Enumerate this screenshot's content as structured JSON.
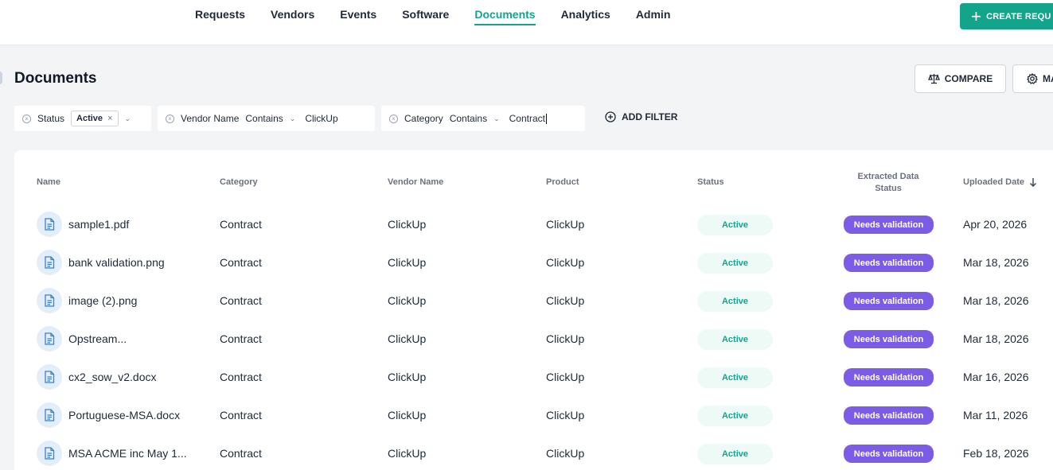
{
  "nav": {
    "items": [
      {
        "label": "Requests",
        "active": false
      },
      {
        "label": "Vendors",
        "active": false
      },
      {
        "label": "Events",
        "active": false
      },
      {
        "label": "Software",
        "active": false
      },
      {
        "label": "Documents",
        "active": true
      },
      {
        "label": "Analytics",
        "active": false
      },
      {
        "label": "Admin",
        "active": false
      }
    ],
    "create_label": "CREATE REQU",
    "accent_color": "#14a38b"
  },
  "page": {
    "title": "Documents",
    "compare_label": "COMPARE",
    "manage_label": "MA"
  },
  "filters": {
    "status": {
      "label": "Status",
      "chip": "Active"
    },
    "vendor": {
      "label": "Vendor Name",
      "operator": "Contains",
      "value": "ClickUp"
    },
    "category": {
      "label": "Category",
      "operator": "Contains",
      "value": "Contract"
    },
    "add_label": "ADD FILTER"
  },
  "table": {
    "headers": {
      "name": "Name",
      "category": "Category",
      "vendor": "Vendor Name",
      "product": "Product",
      "status": "Status",
      "extracted_line1": "Extracted Data",
      "extracted_line2": "Status",
      "uploaded": "Uploaded Date"
    },
    "sort_icon": "arrow-down-icon",
    "rows": [
      {
        "name": "sample1.pdf",
        "category": "Contract",
        "vendor": "ClickUp",
        "product": "ClickUp",
        "status": "Active",
        "extracted": "Needs validation",
        "date": "Apr 20, 2026"
      },
      {
        "name": "bank validation.png",
        "category": "Contract",
        "vendor": "ClickUp",
        "product": "ClickUp",
        "status": "Active",
        "extracted": "Needs validation",
        "date": "Mar 18, 2026"
      },
      {
        "name": "image (2).png",
        "category": "Contract",
        "vendor": "ClickUp",
        "product": "ClickUp",
        "status": "Active",
        "extracted": "Needs validation",
        "date": "Mar 18, 2026"
      },
      {
        "name": "Opstream...",
        "category": "Contract",
        "vendor": "ClickUp",
        "product": "ClickUp",
        "status": "Active",
        "extracted": "Needs validation",
        "date": "Mar 18, 2026"
      },
      {
        "name": "cx2_sow_v2.docx",
        "category": "Contract",
        "vendor": "ClickUp",
        "product": "ClickUp",
        "status": "Active",
        "extracted": "Needs validation",
        "date": "Mar 16, 2026"
      },
      {
        "name": "Portuguese-MSA.docx",
        "category": "Contract",
        "vendor": "ClickUp",
        "product": "ClickUp",
        "status": "Active",
        "extracted": "Needs validation",
        "date": "Mar 11, 2026"
      },
      {
        "name": "MSA ACME inc May 1...",
        "category": "Contract",
        "vendor": "ClickUp",
        "product": "ClickUp",
        "status": "Active",
        "extracted": "Needs validation",
        "date": "Feb 18, 2026"
      }
    ]
  }
}
